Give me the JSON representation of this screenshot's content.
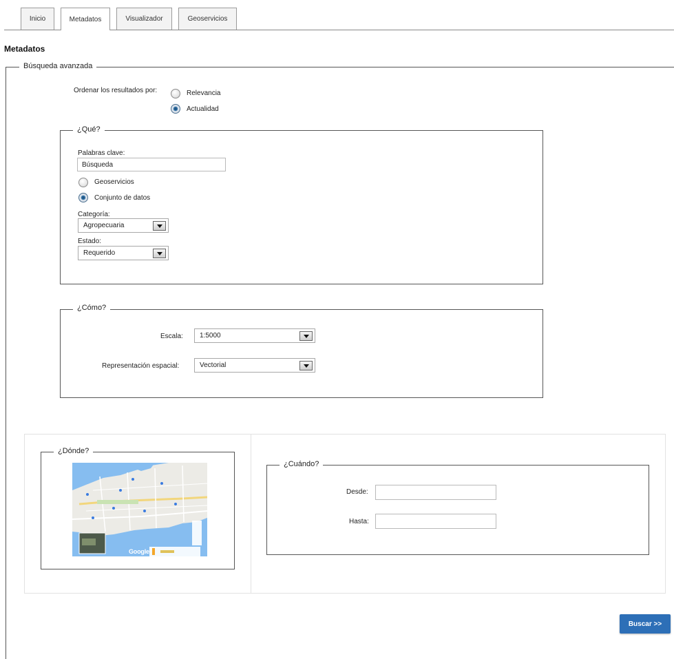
{
  "tabs": [
    {
      "label": "Inicio"
    },
    {
      "label": "Metadatos",
      "active": true
    },
    {
      "label": "Visualizador"
    },
    {
      "label": "Geoservicios"
    }
  ],
  "page_title": "Metadatos",
  "advanced": {
    "legend": "Búsqueda avanzada",
    "order_label": "Ordenar los resultados por:",
    "order_options": [
      {
        "label": "Relevancia",
        "checked": false
      },
      {
        "label": "Actualidad",
        "checked": true
      }
    ]
  },
  "que": {
    "legend": "¿Qué?",
    "keywords_label": "Palabras clave:",
    "keywords_value": "Búsqueda",
    "type_options": [
      {
        "label": "Geoservicios",
        "checked": false
      },
      {
        "label": "Conjunto de datos",
        "checked": true
      }
    ],
    "category_label": "Categoría:",
    "category_value": "Agropecuaria",
    "state_label": "Estado:",
    "state_value": "Requerido"
  },
  "como": {
    "legend": "¿Cómo?",
    "scale_label": "Escala:",
    "scale_value": "1:5000",
    "repr_label": "Representación espacial:",
    "repr_value": "Vectorial"
  },
  "donde": {
    "legend": "¿Dónde?",
    "map_brand": "Google"
  },
  "cuando": {
    "legend": "¿Cuándo?",
    "from_label": "Desde:",
    "from_value": "",
    "to_label": "Hasta:",
    "to_value": ""
  },
  "search_button": "Buscar >>",
  "colors": {
    "button": "#2d6fb7",
    "radio_checked": "#1c4f7a"
  }
}
